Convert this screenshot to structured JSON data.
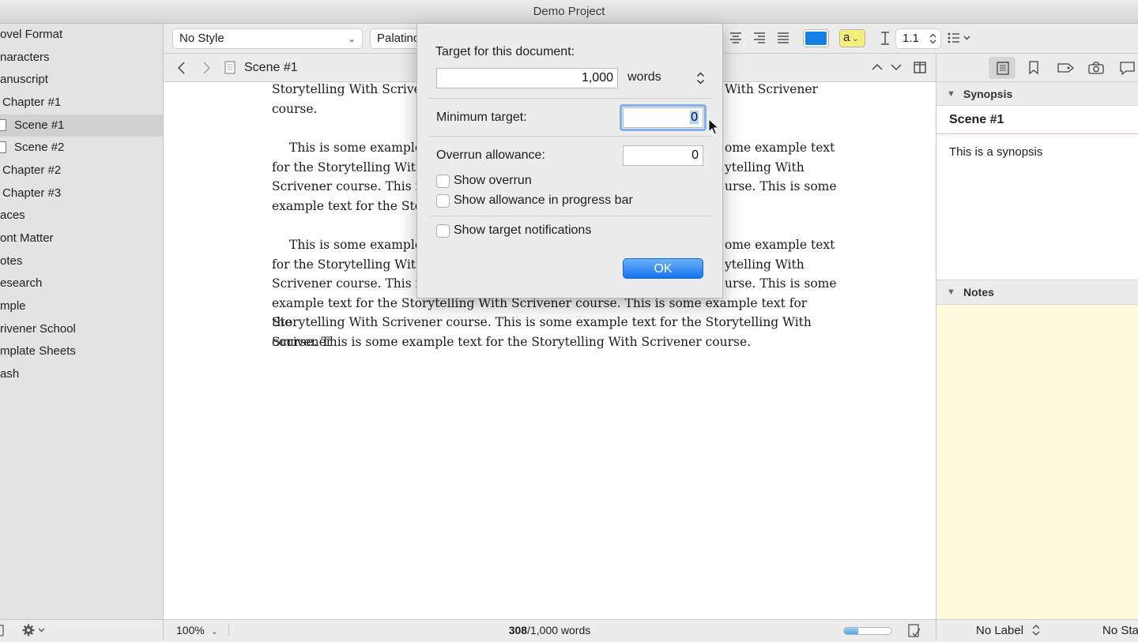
{
  "window": {
    "title": "Demo Project"
  },
  "binder": {
    "items": [
      {
        "label": "ovel Format"
      },
      {
        "label": "naracters"
      },
      {
        "label": "anuscript"
      },
      {
        "label": "Chapter #1"
      },
      {
        "label": "Scene #1"
      },
      {
        "label": "Scene #2"
      },
      {
        "label": "Chapter #2"
      },
      {
        "label": "Chapter #3"
      },
      {
        "label": "aces"
      },
      {
        "label": "ont Matter"
      },
      {
        "label": "otes"
      },
      {
        "label": "esearch"
      },
      {
        "label": "mple"
      },
      {
        "label": "rivener School"
      },
      {
        "label": "mplate Sheets"
      },
      {
        "label": "ash"
      }
    ]
  },
  "formatbar": {
    "style": "No Style",
    "font": "Palatino",
    "line_spacing": "1.1",
    "highlight_label": "a",
    "text_color": "#1480e5",
    "highlight_color": "#f6f07a"
  },
  "header": {
    "doc_title": "Scene #1"
  },
  "editor": {
    "paragraphs": [
      {
        "lines": [
          "Storytelling With Scrivener",
          "With Scrivener",
          "course."
        ]
      },
      {
        "lines": [
          "This is some example t",
          "ome example text",
          "for the Storytelling With S",
          "ytelling With",
          "Scrivener course. This is so",
          "urse. This is some",
          "example text for the Story"
        ]
      },
      {
        "lines": [
          "This is some example t",
          "ome example text",
          "for the Storytelling With S",
          "ytelling With",
          "Scrivener course. This is s",
          "urse. This is some",
          "example text for the Storytelling With Scrivener course. This is some example text for the",
          "Storytelling With Scrivener course. This is some example text for the Storytelling With Scrivener",
          "course. This is some example text for the Storytelling With Scrivener course."
        ]
      }
    ]
  },
  "status": {
    "zoom": "100%",
    "word_count": "308",
    "word_target": "/1,000 words",
    "progress": 0.308
  },
  "inspector": {
    "synopsis_header": "Synopsis",
    "synopsis_title": "Scene #1",
    "synopsis_text": "This is a synopsis",
    "notes_header": "Notes",
    "label": "No Label",
    "status": "No Sta"
  },
  "dialog": {
    "target_label": "Target for this document:",
    "target_value": "1,000",
    "target_unit": "words",
    "minimum_label": "Minimum target:",
    "minimum_value": "0",
    "overrun_label": "Overrun allowance:",
    "overrun_value": "0",
    "show_overrun": "Show overrun",
    "show_allowance": "Show allowance in progress bar",
    "show_notifications": "Show target notifications",
    "ok": "OK"
  }
}
